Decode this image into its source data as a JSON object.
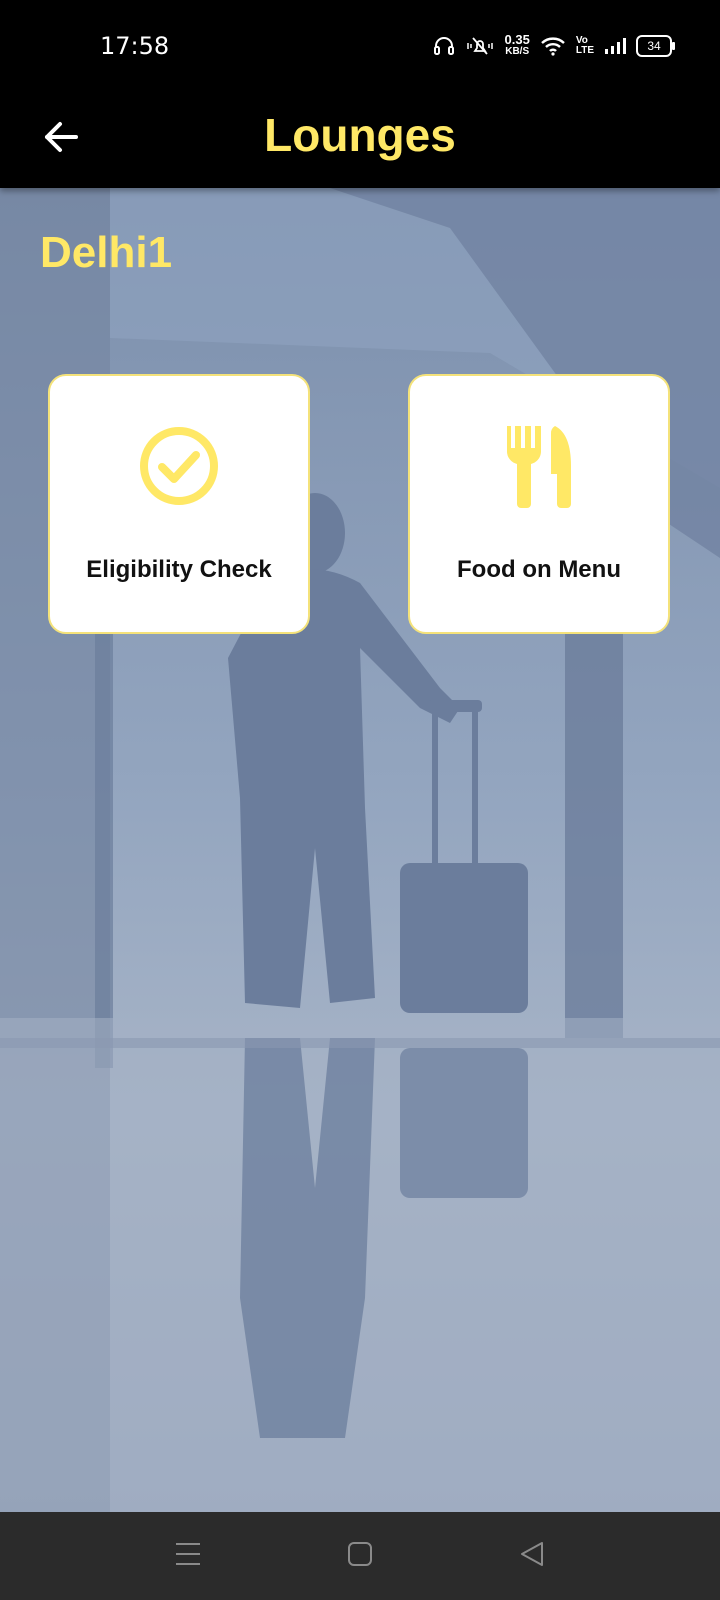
{
  "status_bar": {
    "time": "17:58",
    "net_speed_value": "0.35",
    "net_speed_unit": "KB/S",
    "volte_top": "Vo",
    "volte_bottom": "LTE",
    "battery": "34",
    "icons": [
      "headphones-icon",
      "vibrate-mute-icon",
      "wifi-icon",
      "signal-icon",
      "battery-icon"
    ]
  },
  "app_bar": {
    "title": "Lounges",
    "back_icon": "arrow-left-icon"
  },
  "main": {
    "location_title": "Delhi1",
    "cards": [
      {
        "label": "Eligibility Check",
        "icon": "check-circle-icon"
      },
      {
        "label": "Food on Menu",
        "icon": "fork-knife-icon"
      }
    ]
  },
  "nav_bar": {
    "icons": [
      "menu-icon",
      "home-square-icon",
      "back-triangle-icon"
    ]
  },
  "colors": {
    "accent_yellow": "#ffe866",
    "app_bar_bg": "#000000",
    "content_bg": "#93a5bf",
    "card_bg": "#ffffff",
    "nav_bar_bg": "#2b2b2b"
  }
}
